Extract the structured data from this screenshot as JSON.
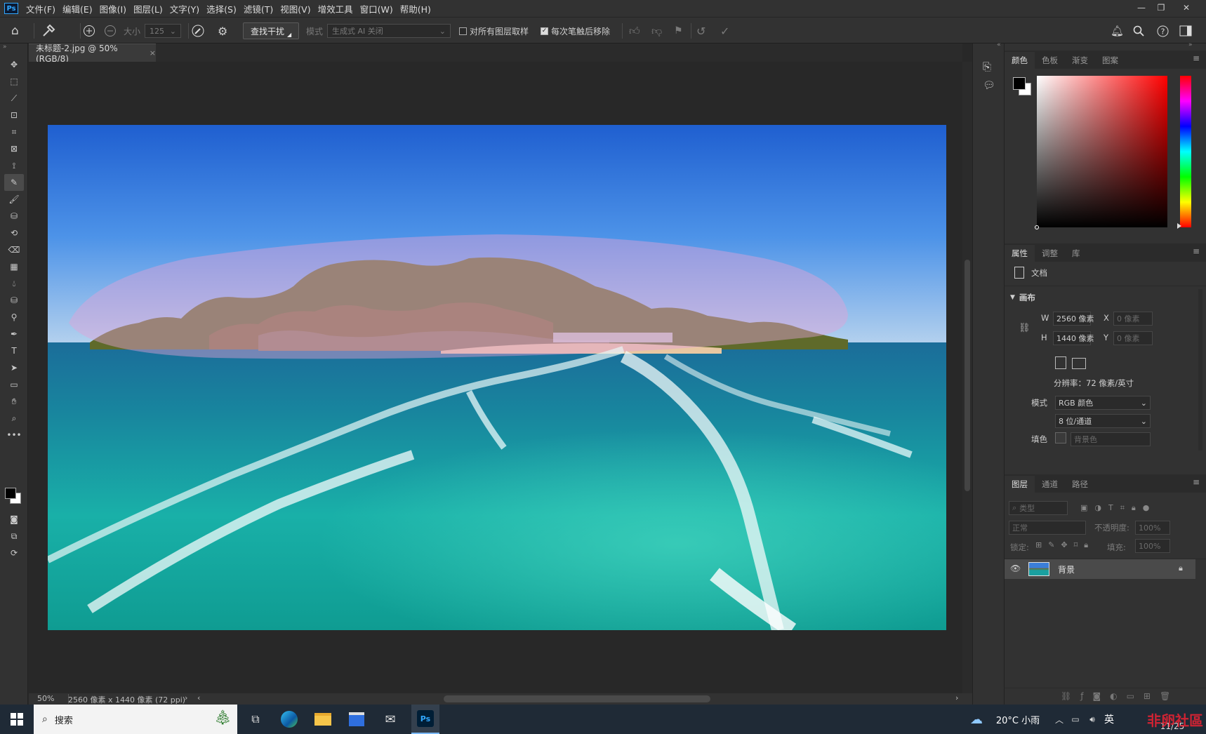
{
  "menubar": {
    "logo": "Ps",
    "items": [
      "文件(F)",
      "编辑(E)",
      "图像(I)",
      "图层(L)",
      "文字(Y)",
      "选择(S)",
      "滤镜(T)",
      "视图(V)",
      "增效工具",
      "窗口(W)",
      "帮助(H)"
    ]
  },
  "options_bar": {
    "size_label": "大小",
    "size_value": "125",
    "find_distractions": "查找干扰",
    "mode_label": "模式",
    "mode_value": "生成式 AI 关闭",
    "sample_all_layers": "对所有图层取样",
    "sample_all_checked": false,
    "remove_after_stroke": "每次笔触后移除",
    "remove_after_checked": true
  },
  "document": {
    "tab_title": "未标题-2.jpg @ 50%(RGB/8)",
    "zoom": "50%",
    "dimensions": "2560 像素 x 1440 像素 (72 ppi)"
  },
  "color_panel": {
    "tabs": [
      "颜色",
      "色板",
      "渐变",
      "图案"
    ],
    "active_tab": "颜色",
    "foreground": "#000000",
    "background": "#ffffff",
    "hue_color": "#ff0000"
  },
  "properties_panel": {
    "tabs": [
      "属性",
      "调整",
      "库"
    ],
    "active_tab": "属性",
    "doc_label": "文档",
    "section": "画布",
    "w_label": "W",
    "w_value": "2560 像素",
    "h_label": "H",
    "h_value": "1440 像素",
    "x_label": "X",
    "x_value": "0 像素",
    "y_label": "Y",
    "y_value": "0 像素",
    "resolution": "分辨率：72 像素/英寸",
    "mode_label": "模式",
    "mode_value": "RGB 颜色",
    "bit_depth": "8 位/通道",
    "fill_label": "填色",
    "fill_value": "背景色"
  },
  "layers_panel": {
    "tabs": [
      "图层",
      "通道",
      "路径"
    ],
    "active_tab": "图层",
    "filter_placeholder": "类型",
    "blend_mode": "正常",
    "opacity_label": "不透明度:",
    "opacity_value": "100%",
    "lock_label": "锁定:",
    "fill_label": "填充:",
    "fill_value": "100%",
    "layers": [
      {
        "name": "背景",
        "visible": true,
        "locked": true
      }
    ]
  },
  "taskbar": {
    "search": "搜索",
    "weather": "20°C 小雨",
    "ime": "英",
    "date": "11/25",
    "watermark": "非卵社區"
  }
}
